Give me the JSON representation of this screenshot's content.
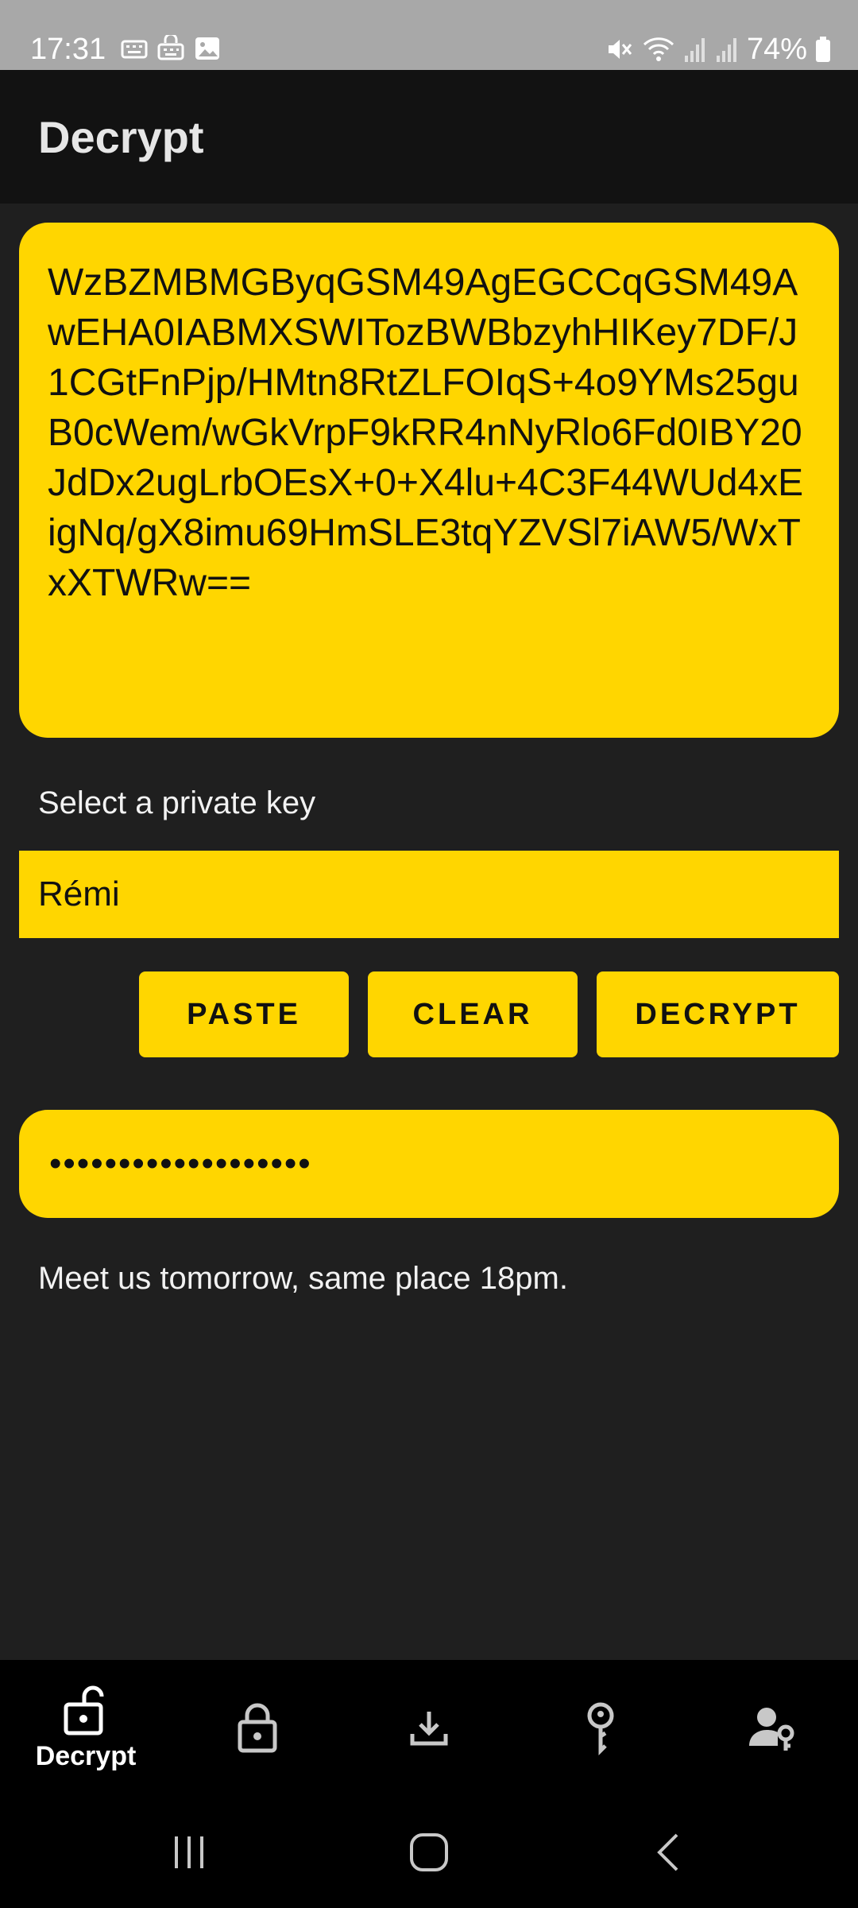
{
  "status_bar": {
    "time": "17:31",
    "battery": "74%",
    "icons": [
      "keyboard-icon",
      "keyboard-lock-icon",
      "image-icon",
      "mute-icon",
      "wifi-icon",
      "signal-icon",
      "signal-icon",
      "battery-icon"
    ]
  },
  "app_bar": {
    "title": "Decrypt"
  },
  "cipher": {
    "text": "WzBZMBMGByqGSM49AgEGCCqGSM49AwEHA0IABMXSWITozBWBbzyhHIKey7DF/J1CGtFnPjp/HMtn8RtZLFOIqS+4o9YMs25guB0cWem/wGkVrpF9kRR4nNyRlo6Fd0IBY20JdDx2ugLrbOEsX+0+X4lu+4C3F44WUd4xEigNq/gX8imu69HmSLE3tqYZVSl7iAW5/WxTxXTWRw=="
  },
  "key_select": {
    "label": "Select a private key",
    "selected": "Rémi"
  },
  "buttons": {
    "paste": "PASTE",
    "clear": "CLEAR",
    "decrypt": "DECRYPT"
  },
  "password": {
    "masked_value": "•••••••••••••••••••"
  },
  "result": {
    "text": "Meet us tomorrow, same place 18pm."
  },
  "bottom_nav": {
    "items": [
      {
        "label": "Decrypt",
        "icon": "lock-open-icon",
        "active": true
      },
      {
        "label": "",
        "icon": "lock-icon",
        "active": false
      },
      {
        "label": "",
        "icon": "download-icon",
        "active": false
      },
      {
        "label": "",
        "icon": "key-icon",
        "active": false
      },
      {
        "label": "",
        "icon": "person-key-icon",
        "active": false
      }
    ]
  },
  "colors": {
    "accent": "#ffd600",
    "background": "#1f1f1f",
    "app_bar": "#121212",
    "status_bar": "#a8a8a8"
  }
}
